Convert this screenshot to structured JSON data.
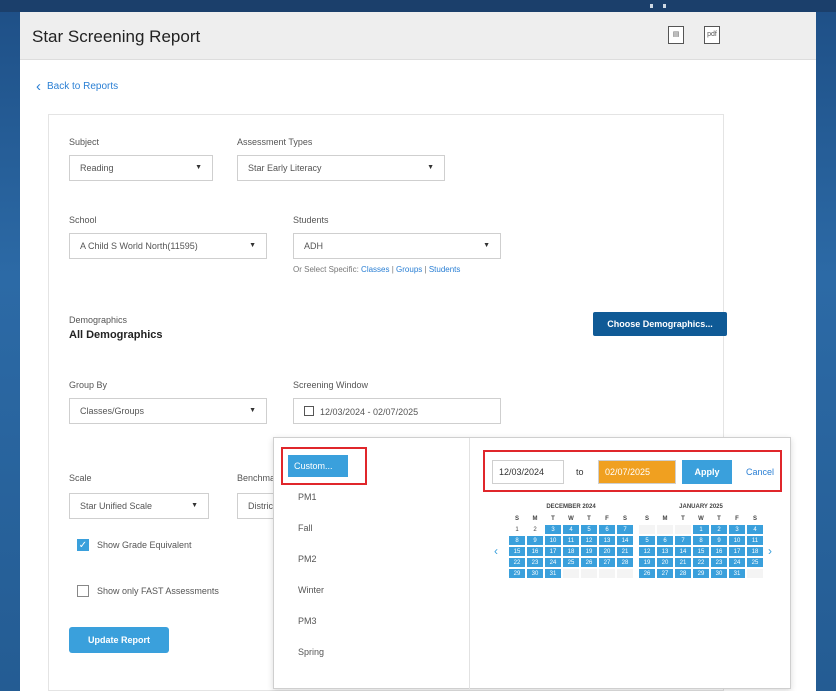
{
  "header": {
    "title": "Star Screening Report",
    "icon1": "chart-icon",
    "icon2": "pdf-icon"
  },
  "back_link": "Back to Reports",
  "subject": {
    "label": "Subject",
    "value": "Reading"
  },
  "assessment_types": {
    "label": "Assessment Types",
    "value": "Star Early Literacy"
  },
  "school": {
    "label": "School",
    "value": "A Child S World North(11595)"
  },
  "students": {
    "label": "Students",
    "value": "ADH",
    "or_select": "Or Select Specific:",
    "links": [
      "Classes",
      "Groups",
      "Students"
    ],
    "sep": "|"
  },
  "demographics": {
    "label": "Demographics",
    "value": "All Demographics",
    "button": "Choose Demographics..."
  },
  "group_by": {
    "label": "Group By",
    "value": "Classes/Groups"
  },
  "screening_window": {
    "label": "Screening Window",
    "value": "12/03/2024 - 02/07/2025"
  },
  "scale": {
    "label": "Scale",
    "value": "Star Unified Scale"
  },
  "benchmark": {
    "label": "Benchmark",
    "value": "District"
  },
  "checks": [
    {
      "label": "Show Grade Equivalent",
      "checked": true
    },
    {
      "label": "Show only FAST Assessments",
      "checked": false
    }
  ],
  "update_button": "Update Report",
  "popup": {
    "options": [
      "Custom...",
      "PM1",
      "Fall",
      "PM2",
      "Winter",
      "PM3",
      "Spring"
    ],
    "start": "12/03/2024",
    "to": "to",
    "end": "02/07/2025",
    "apply": "Apply",
    "cancel": "Cancel",
    "calendars": [
      {
        "title": "DECEMBER 2024",
        "dow": [
          "S",
          "M",
          "T",
          "W",
          "T",
          "F",
          "S"
        ],
        "days": [
          "1",
          "2",
          "3",
          "4",
          "5",
          "6",
          "7",
          "8",
          "9",
          "10",
          "11",
          "12",
          "13",
          "14",
          "15",
          "16",
          "17",
          "18",
          "19",
          "20",
          "21",
          "22",
          "23",
          "24",
          "25",
          "26",
          "27",
          "28",
          "29",
          "30",
          "31",
          "",
          "",
          "",
          ""
        ],
        "selected_from": 3
      },
      {
        "title": "JANUARY 2025",
        "dow": [
          "S",
          "M",
          "T",
          "W",
          "T",
          "F",
          "S"
        ],
        "days": [
          "",
          "",
          "",
          "1",
          "2",
          "3",
          "4",
          "5",
          "6",
          "7",
          "8",
          "9",
          "10",
          "11",
          "12",
          "13",
          "14",
          "15",
          "16",
          "17",
          "18",
          "19",
          "20",
          "21",
          "22",
          "23",
          "24",
          "25",
          "26",
          "27",
          "28",
          "29",
          "30",
          "31",
          ""
        ],
        "selected_from": 0
      }
    ]
  }
}
